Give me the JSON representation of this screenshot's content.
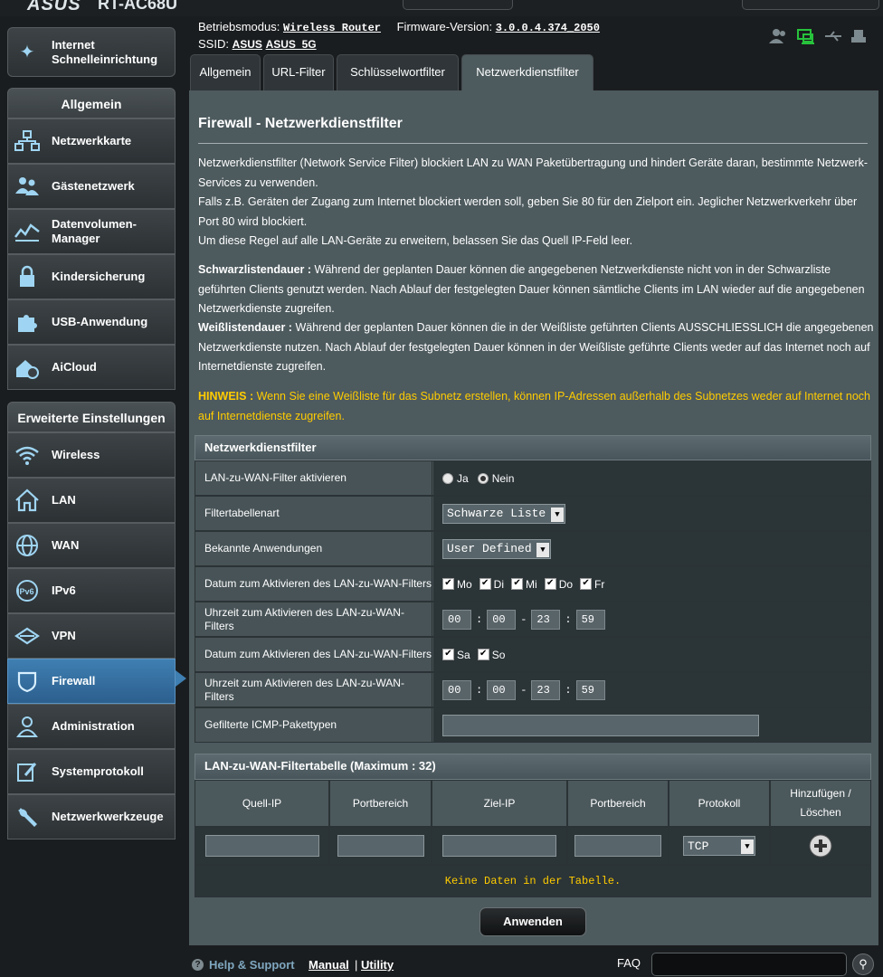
{
  "brand": {
    "logo": "ASUS",
    "model": "RT-AC68U"
  },
  "header": {
    "mode_label": "Betriebsmodus:",
    "mode_value": "Wireless Router",
    "fw_label": "Firmware-Version:",
    "fw_value": "3.0.0.4.374_2050",
    "ssid_label": "SSID:",
    "ssid_1": "ASUS",
    "ssid_2": "ASUS_5G"
  },
  "sidebar": {
    "quick_setup": "Internet Schnelleinrichtung",
    "general_head": "Allgemein",
    "general_items": [
      "Netzwerkkarte",
      "Gästenetzwerk",
      "Datenvolumen-Manager",
      "Kindersicherung",
      "USB-Anwendung",
      "AiCloud"
    ],
    "advanced_head": "Erweiterte Einstellungen",
    "advanced_items": [
      "Wireless",
      "LAN",
      "WAN",
      "IPv6",
      "VPN",
      "Firewall",
      "Administration",
      "Systemprotokoll",
      "Netzwerkwerkzeuge"
    ]
  },
  "tabs": [
    "Allgemein",
    "URL-Filter",
    "Schlüsselwortfilter",
    "Netzwerkdienstfilter"
  ],
  "page": {
    "title": "Firewall - Netzwerkdienstfilter",
    "desc1": "Netzwerkdienstfilter (Network Service Filter) blockiert LAN zu WAN Paketübertragung und hindert Geräte daran, bestimmte Netzwerk-Services zu verwenden.",
    "desc2": "Falls z.B. Geräten der Zugang zum Internet blockiert werden soll, geben Sie 80 für den Zielport ein. Jeglicher Netzwerkverkehr über Port 80 wird blockiert.",
    "desc3": "Um diese Regel auf alle LAN-Geräte zu erweitern, belassen Sie das Quell IP-Feld leer.",
    "black_label": "Schwarzlistendauer :",
    "black_text": " Während der geplanten Dauer können die angegebenen Netzwerkdienste nicht von in der Schwarzliste geführten Clients genutzt werden. Nach Ablauf der festgelegten Dauer können sämtliche Clients im LAN wieder auf die angegebenen Netzwerkdienste zugreifen.",
    "white_label": "Weißlistendauer :",
    "white_text": " Während der geplanten Dauer können die in der Weißliste geführten Clients AUSSCHLIESSLICH die angegebenen Netzwerkdienste nutzen. Nach Ablauf der festgelegten Dauer können in der Weißliste geführte Clients weder auf das Internet noch auf Internetdienste zugreifen.",
    "note_label": "HINWEIS :",
    "note_text": " Wenn Sie eine Weißliste für das Subnetz erstellen, können IP-Adressen außerhalb des Subnetzes weder auf Internet noch auf Internetdienste zugreifen."
  },
  "filter": {
    "head": "Netzwerkdienstfilter",
    "enable_label": "LAN-zu-WAN-Filter aktivieren",
    "yes": "Ja",
    "no": "Nein",
    "enabled": false,
    "type_label": "Filtertabellenart",
    "type_value": "Schwarze Liste",
    "apps_label": "Bekannte Anwendungen",
    "apps_value": "User Defined",
    "weekday_date_label": "Datum zum Aktivieren des LAN-zu-WAN-Filters",
    "weekdays": [
      "Mo",
      "Di",
      "Mi",
      "Do",
      "Fr"
    ],
    "weekday_time_label": "Uhrzeit zum Aktivieren des LAN-zu-WAN-Filters",
    "weekday_time": [
      "00",
      "00",
      "23",
      "59"
    ],
    "weekend_date_label": "Datum zum Aktivieren des LAN-zu-WAN-Filters",
    "weekend": [
      "Sa",
      "So"
    ],
    "weekend_time_label": "Uhrzeit zum Aktivieren des LAN-zu-WAN-Filters",
    "weekend_time": [
      "00",
      "00",
      "23",
      "59"
    ],
    "icmp_label": "Gefilterte ICMP-Pakettypen",
    "icmp_value": ""
  },
  "rules": {
    "head": "LAN-zu-WAN-Filtertabelle (Maximum : 32)",
    "columns": [
      "Quell-IP",
      "Portbereich",
      "Ziel-IP",
      "Portbereich",
      "Protokoll",
      "Hinzufügen / Löschen"
    ],
    "protocol_value": "TCP",
    "empty": "Keine Daten in der Tabelle."
  },
  "apply": "Anwenden",
  "footer": {
    "help": "Help & Support",
    "manual": "Manual",
    "divider": "|",
    "utility": "Utility",
    "faq": "FAQ"
  },
  "colors": {
    "accent": "#3f7fb2",
    "note": "#ffcc00",
    "panel": "#4d5a5e"
  }
}
